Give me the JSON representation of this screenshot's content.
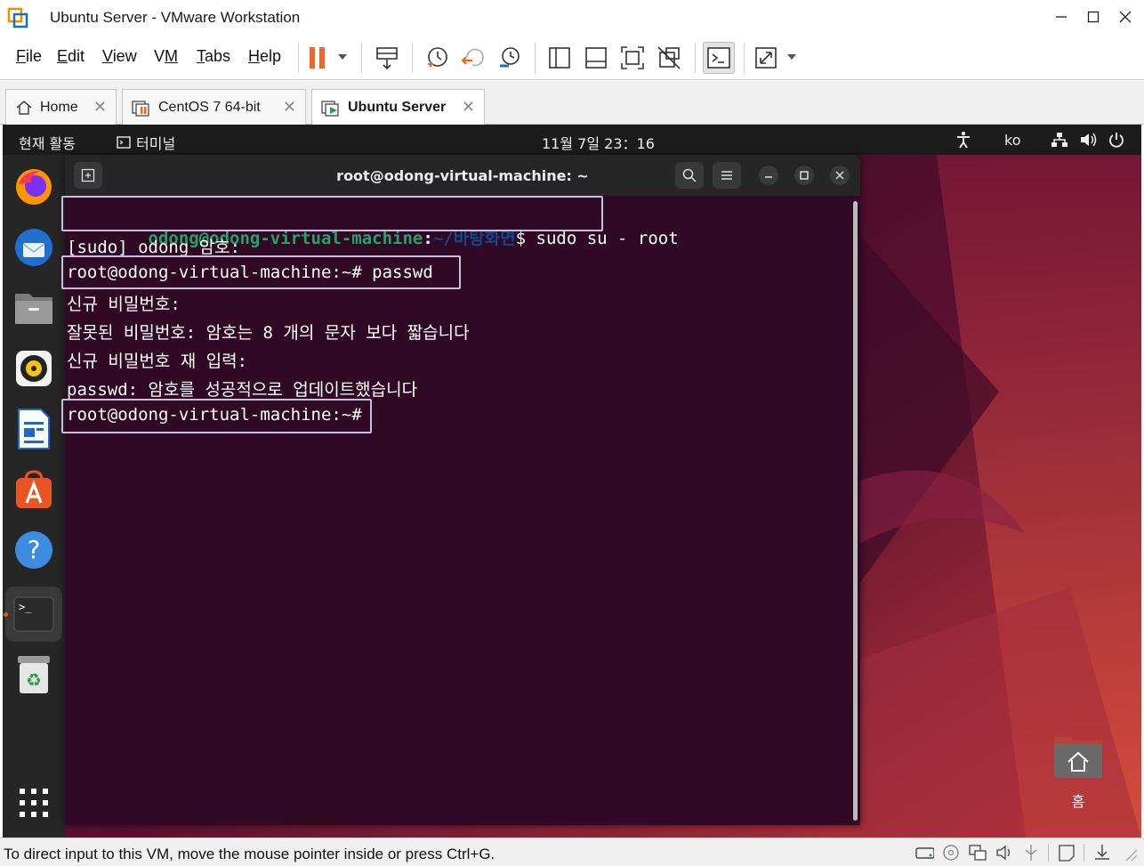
{
  "window": {
    "title": "Ubuntu Server - VMware Workstation",
    "controls": [
      "minimize",
      "maximize",
      "close"
    ]
  },
  "menubar": {
    "items": [
      "File",
      "Edit",
      "View",
      "VM",
      "Tabs",
      "Help"
    ],
    "underline": [
      "F",
      "E",
      "V",
      "M",
      "T",
      "H"
    ]
  },
  "toolbar": {
    "icons": [
      "pause-icon",
      "send-keys-icon",
      "snapshot-icon",
      "revert-snapshot-icon",
      "snapshot-manager-icon",
      "library-icon",
      "thumbnail-icon",
      "fullscreen-icon",
      "unity-icon",
      "console-icon",
      "stretch-icon"
    ]
  },
  "tabs": [
    {
      "label": "Home",
      "icon": "home-icon",
      "active": false
    },
    {
      "label": "CentOS 7 64-bit",
      "icon": "vm-paused-icon",
      "active": false
    },
    {
      "label": "Ubuntu Server",
      "icon": "vm-running-icon",
      "active": true
    }
  ],
  "ubuntu": {
    "activities": "현재 활동",
    "app_name": "터미널",
    "clock": "11월 7일  23：16",
    "keyboard": "ko",
    "dock": [
      "firefox-icon",
      "thunderbird-icon",
      "files-icon",
      "rhythmbox-icon",
      "writer-icon",
      "app-center-icon",
      "help-icon",
      "terminal-icon",
      "trash-icon",
      "show-apps-icon"
    ],
    "desktop_icon_label": "홈"
  },
  "terminal": {
    "title": "root@odong-virtual-machine: ~",
    "lines": [
      {
        "user": "odong@odong-virtual-machine",
        "colon": ":",
        "path": "~/바탕화면",
        "rest": "$ sudo su - root"
      },
      {
        "text": "[sudo] odong 암호:"
      },
      {
        "text": "root@odong-virtual-machine:~# passwd"
      },
      {
        "text": "신규 비밀번호:"
      },
      {
        "text": "잘못된 비밀번호: 암호는 8 개의 문자 보다 짧습니다"
      },
      {
        "text": "신규 비밀번호 재 입력:"
      },
      {
        "text": "passwd: 암호를 성공적으로 업데이트했습니다"
      },
      {
        "text": "root@odong-virtual-machine:~#"
      }
    ]
  },
  "statusbar": {
    "text": "To direct input to this VM, move the mouse pointer inside or press Ctrl+G."
  },
  "colors": {
    "terminal_bg": "#300a24",
    "prompt_green": "#26a269",
    "prompt_blue": "#12488b",
    "highlight": "#c9bde0"
  }
}
